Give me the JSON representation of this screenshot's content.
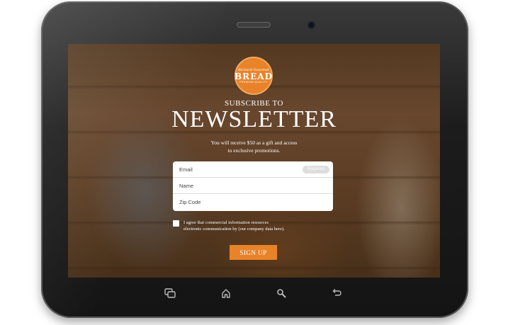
{
  "logo": {
    "script_text": "Richard Gourmet",
    "brand": "BREAD",
    "tagline": "PREMIUM QUALITY"
  },
  "header": {
    "subscribe": "SUBSCRIBE TO",
    "title": "NEWSLETTER",
    "description_line1": "You will receive $50 as a gift and access",
    "description_line2": "to exclusive promotions."
  },
  "form": {
    "email_placeholder": "Email",
    "required_badge": "Required",
    "name_placeholder": "Name",
    "zip_placeholder": "Zip Code"
  },
  "agreement": {
    "line1": "I agree that commercial information resources",
    "line2": "electronic communication by (our company data here)."
  },
  "cta": {
    "label": "SIGN UP"
  },
  "colors": {
    "accent": "#e8832a",
    "bezel": "#1c1c1c",
    "text_on_image": "#ffffff"
  },
  "device_nav": {
    "icons": [
      "recent-apps-icon",
      "home-icon",
      "search-icon",
      "back-icon"
    ]
  }
}
